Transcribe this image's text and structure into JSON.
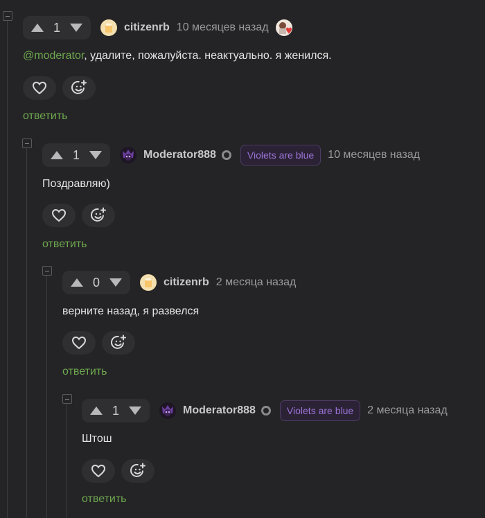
{
  "comments": [
    {
      "rating": "1",
      "author": "citizenrb",
      "time": "10 месяцев назад",
      "mention": "@moderator",
      "text": ", удалите, пожалуйста. неактуально. я женился.",
      "reply_label": "ответить"
    },
    {
      "rating": "1",
      "author": "Moderator888",
      "badge": "Violets are blue",
      "time": "10 месяцев назад",
      "text": "Поздравляю)",
      "reply_label": "ответить"
    },
    {
      "rating": "0",
      "author": "citizenrb",
      "time": "2 месяца назад",
      "text": "верните назад, я развелся",
      "reply_label": "ответить"
    },
    {
      "rating": "1",
      "author": "Moderator888",
      "badge": "Violets are blue",
      "time": "2 месяца назад",
      "text": "Штош",
      "reply_label": "ответить"
    }
  ],
  "icons": {
    "upvote": "triangle-up-icon",
    "downvote": "triangle-down-icon",
    "like": "heart-icon",
    "react": "emoji-add-icon",
    "collapse": "collapse-minus-icon"
  },
  "colors": {
    "background": "#242426",
    "link_green": "#6fa84f",
    "badge_purple": "#9c74d6"
  }
}
